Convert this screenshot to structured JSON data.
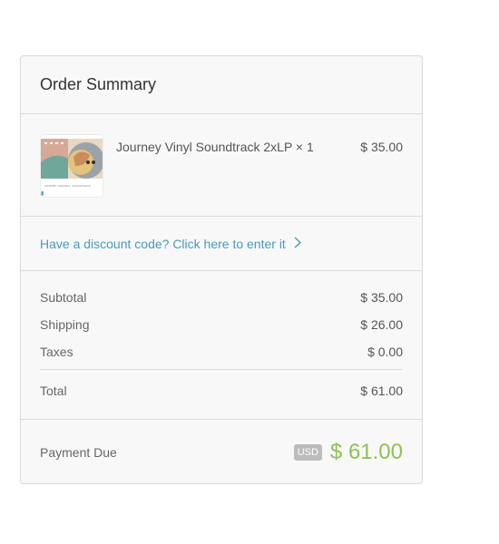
{
  "order_summary": {
    "title": "Order Summary",
    "product": {
      "name": "Journey Vinyl Soundtrack 2xLP × 1",
      "price": "$ 35.00",
      "thumbnail_caption": "JOURNEY ORIGINAL SOUNDTRACK",
      "thumbnail_mark": "▮"
    },
    "discount": {
      "link_text": "Have a discount code? Click here to enter it",
      "icon": "chevron-right-icon"
    },
    "totals": {
      "subtotal_label": "Subtotal",
      "subtotal_value": "$ 35.00",
      "shipping_label": "Shipping",
      "shipping_value": "$ 26.00",
      "taxes_label": "Taxes",
      "taxes_value": "$ 0.00",
      "total_label": "Total",
      "total_value": "$ 61.00"
    },
    "payment": {
      "label": "Payment Due",
      "currency": "USD",
      "amount": "$ 61.00"
    }
  },
  "colors": {
    "link": "#4a9ab8",
    "amount_due": "#8fc156",
    "badge": "#bcbcbc",
    "border": "#d9d9d9",
    "card_bg": "#f8f8f8"
  }
}
